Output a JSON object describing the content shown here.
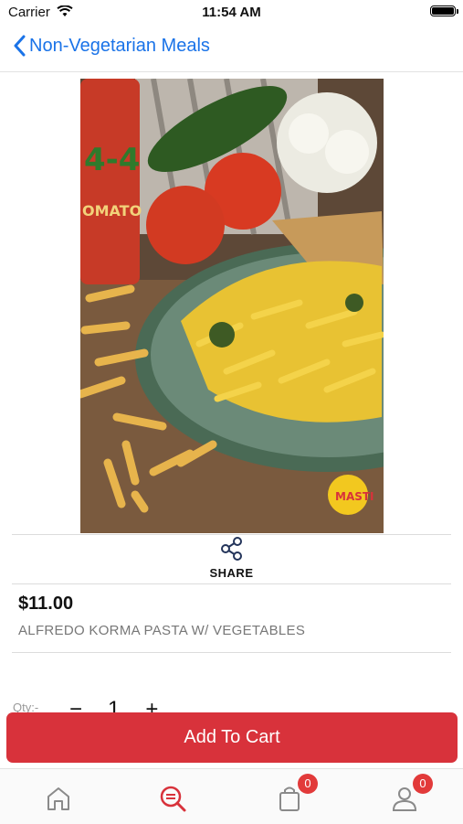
{
  "status_bar": {
    "carrier": "Carrier",
    "time": "11:54 AM"
  },
  "navbar": {
    "back_label": "Non-Vegetarian Meals"
  },
  "product": {
    "image_icon": "pasta-photo",
    "share_label": "SHARE",
    "price": "$11.00",
    "name": "ALFREDO KORMA PASTA W/ VEGETABLES",
    "watermark": "MASTI"
  },
  "quantity": {
    "label": "Qty:-",
    "minus": "−",
    "value": "1",
    "plus": "+"
  },
  "cart_button": {
    "label": "Add To Cart"
  },
  "tabbar": {
    "tabs": [
      {
        "icon": "home-icon"
      },
      {
        "icon": "search-icon",
        "active": true,
        "color": "#d8323b"
      },
      {
        "icon": "cart-icon",
        "badge": "0"
      },
      {
        "icon": "profile-icon",
        "badge": "0"
      }
    ]
  },
  "colors": {
    "accent": "#1a73e8",
    "primary": "#d8323b",
    "badge": "#e23a3a"
  }
}
